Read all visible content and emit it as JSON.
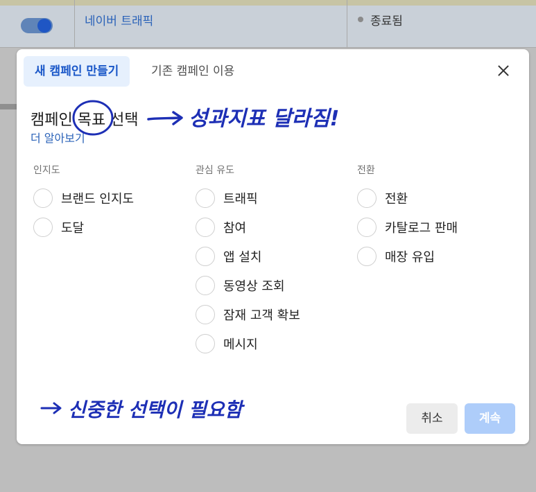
{
  "background": {
    "campaign_name": "네이버 트래픽",
    "status": "종료됨"
  },
  "modal": {
    "tabs": [
      {
        "label": "새 캠페인 만들기"
      },
      {
        "label": "기존 캠페인 이용"
      }
    ],
    "heading": "캠페인 목표 선택",
    "learn_more": "더 알아보기",
    "groups": [
      {
        "title": "인지도",
        "options": [
          "브랜드 인지도",
          "도달"
        ]
      },
      {
        "title": "관심 유도",
        "options": [
          "트래픽",
          "참여",
          "앱 설치",
          "동영상 조회",
          "잠재 고객 확보",
          "메시지"
        ]
      },
      {
        "title": "전환",
        "options": [
          "전환",
          "카탈로그 판매",
          "매장 유입"
        ]
      }
    ],
    "buttons": {
      "cancel": "취소",
      "continue": "계속"
    }
  },
  "annotations": {
    "top_note": "성과지표 달라짐!",
    "bottom_note": "신중한 선택이 필요함"
  },
  "colors": {
    "accent": "#1a57c8",
    "annotation_ink": "#1d2fb5"
  }
}
